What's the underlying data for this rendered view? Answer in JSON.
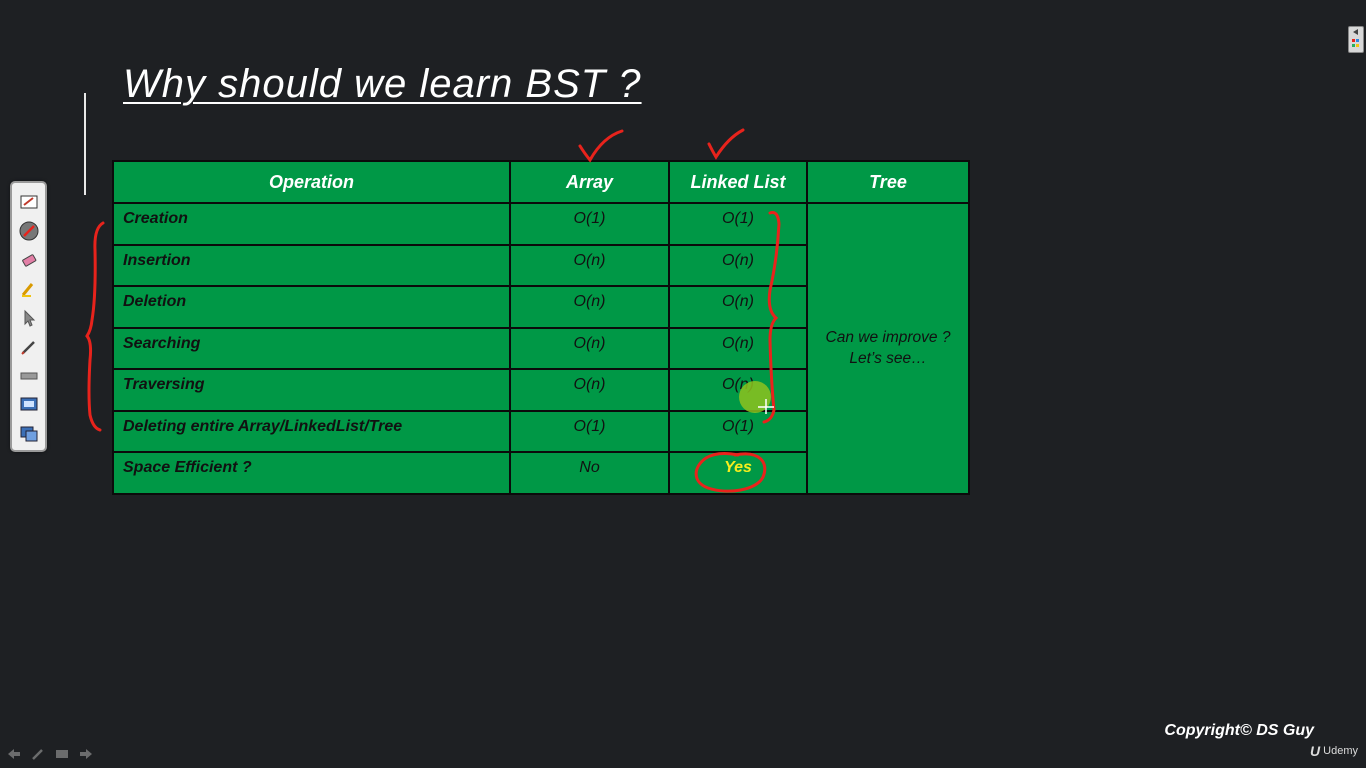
{
  "slide": {
    "title": "Why should we learn BST ?"
  },
  "table": {
    "headers": [
      "Operation",
      "Array",
      "Linked List",
      "Tree"
    ],
    "rows": [
      {
        "operation": "Creation",
        "array": "O(1)",
        "linked_list": "O(1)"
      },
      {
        "operation": "Insertion",
        "array": "O(n)",
        "linked_list": "O(n)"
      },
      {
        "operation": "Deletion",
        "array": "O(n)",
        "linked_list": "O(n)"
      },
      {
        "operation": "Searching",
        "array": "O(n)",
        "linked_list": "O(n)"
      },
      {
        "operation": "Traversing",
        "array": "O(n)",
        "linked_list": "O(n)"
      },
      {
        "operation": "Deleting entire Array/LinkedList/Tree",
        "array": "O(1)",
        "linked_list": "O(1)"
      },
      {
        "operation": "Space Efficient  ?",
        "array": "No",
        "linked_list": "Yes"
      }
    ],
    "tree_note": {
      "line1": "Can we improve ?",
      "line2": "Let’s see…"
    }
  },
  "toolbar": {
    "tools": [
      "whiteboard-icon",
      "pen-settings-icon",
      "eraser-icon",
      "highlighter-icon",
      "pointer-icon",
      "pen-icon",
      "line-icon",
      "screen-capture-icon",
      "window-capture-icon"
    ]
  },
  "footer": {
    "copyright": "Copyright© DS Guy",
    "brand": "Udemy",
    "brand_mark": "U"
  },
  "colors": {
    "background": "#1e2023",
    "table_green": "#009846",
    "highlight_yellow": "#f6ee1d",
    "annotation_red": "#e8231c",
    "pointer_green": "#8dc21f"
  }
}
